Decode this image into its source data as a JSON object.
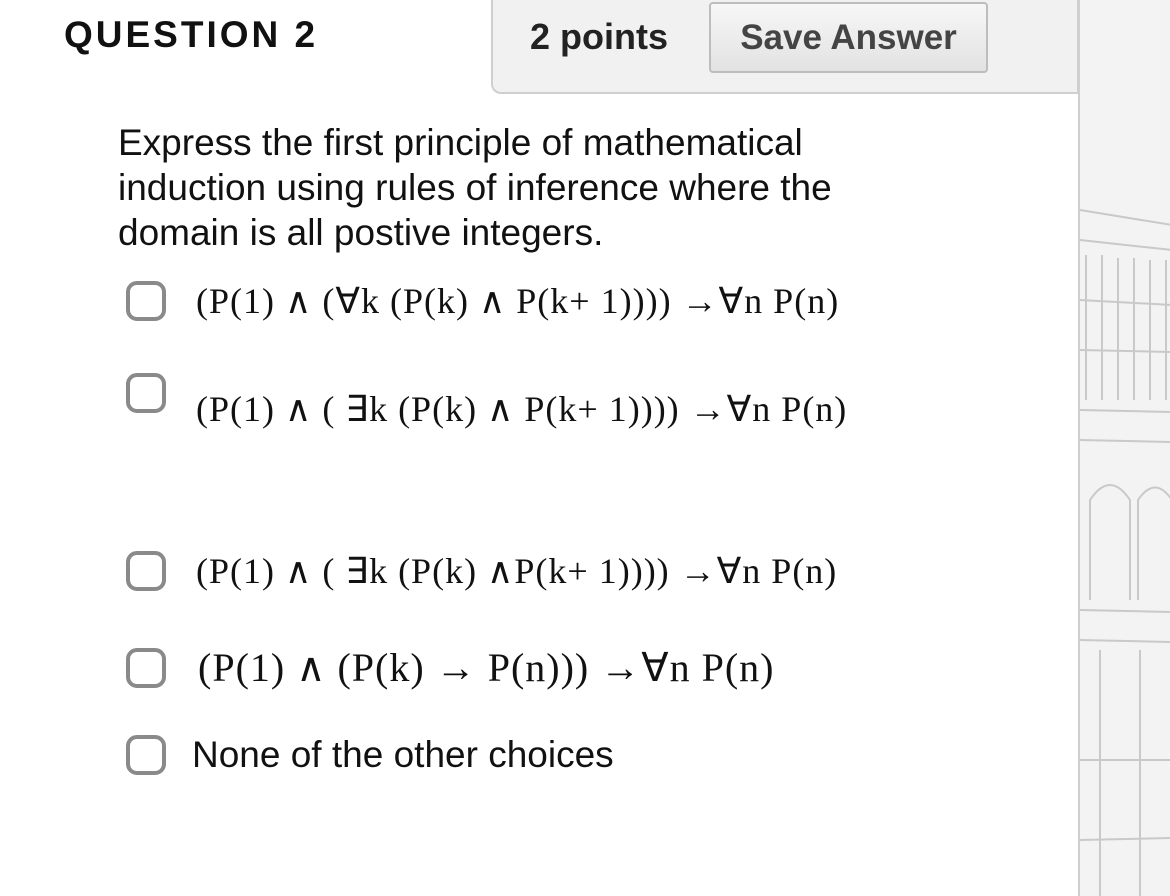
{
  "question": {
    "title": "QUESTION 2",
    "points": "2 points",
    "save_label": "Save Answer",
    "prompt": "Express the first principle of mathematical induction using rules of inference where the domain is all postive integers."
  },
  "choices": [
    {
      "label": "(P(1) ∧ (∀k (P(k) ∧ P(k+ 1)))) →∀n P(n)",
      "selected": false
    },
    {
      "label": "(P(1) ∧ ( ∃k (P(k) ∧ P(k+ 1)))) →∀n P(n)",
      "selected": false
    },
    {
      "label": "(P(1) ∧ ( ∃k (P(k) ∧P(k+ 1)))) →∀n P(n)",
      "selected": false
    },
    {
      "label": "(P(1) ∧ (P(k) → P(n))) →∀n P(n)",
      "selected": false
    },
    {
      "label": "None of the other choices",
      "selected": false
    }
  ]
}
